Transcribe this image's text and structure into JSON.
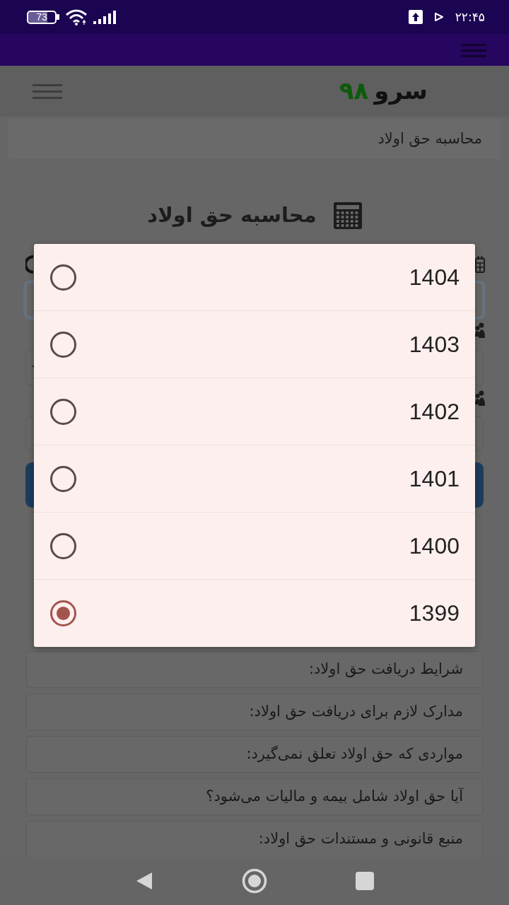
{
  "status_bar": {
    "battery": "73",
    "time": "۲۲:۴۵"
  },
  "header": {
    "logo_word": "سرو",
    "logo_number": "۹۸"
  },
  "breadcrumb": {
    "current": "محاسبه حق اولاد"
  },
  "page_title": "محاسبه حق اولاد",
  "year_dialog": {
    "options": [
      {
        "label": "1404",
        "selected": false
      },
      {
        "label": "1403",
        "selected": false
      },
      {
        "label": "1402",
        "selected": false
      },
      {
        "label": "1401",
        "selected": false
      },
      {
        "label": "1400",
        "selected": false
      },
      {
        "label": "1399",
        "selected": true
      }
    ]
  },
  "faq_items": [
    {
      "title": "شرایط دریافت حق اولاد:"
    },
    {
      "title": "مدارک لازم برای دریافت حق اولاد:"
    },
    {
      "title": "مواردی که حق اولاد تعلق نمی‌گیرد:"
    },
    {
      "title": "آیا حق اولاد شامل بیمه و مالیات می‌شود؟"
    },
    {
      "title": "منبع قانونی و مستندات حق اولاد:"
    }
  ]
}
